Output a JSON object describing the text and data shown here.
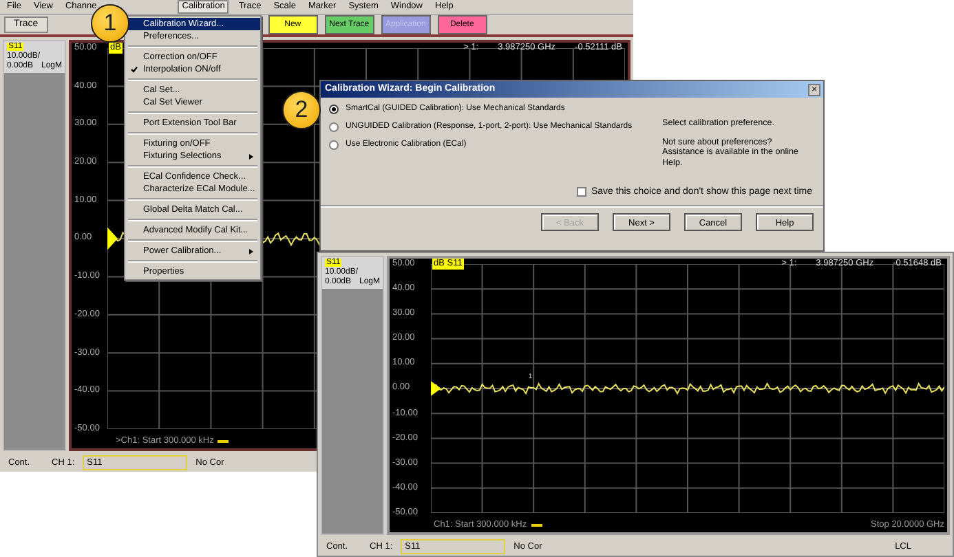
{
  "back_window": {
    "menu_bar": [
      {
        "label": "File",
        "selected": false
      },
      {
        "label": "View",
        "selected": false
      },
      {
        "label": "Channe",
        "selected": false
      },
      {
        "label": "Calibration",
        "selected": true
      },
      {
        "label": "Trace",
        "selected": false
      },
      {
        "label": "Scale",
        "selected": false
      },
      {
        "label": "Marker",
        "selected": false
      },
      {
        "label": "System",
        "selected": false
      },
      {
        "label": "Window",
        "selected": false
      },
      {
        "label": "Help",
        "selected": false
      }
    ],
    "toolbar": {
      "trace_label": "Trace",
      "buttons": [
        {
          "label": "New",
          "color": "#ffff33",
          "disabled": false
        },
        {
          "label": "Next Trace",
          "color": "#66cc66",
          "disabled": false
        },
        {
          "label": "Application",
          "color": "#9999dd",
          "disabled": true
        },
        {
          "label": "Delete",
          "color": "#ff6699",
          "disabled": false
        }
      ]
    },
    "channel_panel": {
      "trace": "S11",
      "scale": "10.00dB/",
      "reference": "0.00dB",
      "format": "LogM"
    },
    "plot": {
      "y_labels": [
        "50.00",
        "40.00",
        "30.00",
        "20.00",
        "10.00",
        "0.00",
        "-10.00",
        "-20.00",
        "-30.00",
        "-40.00",
        "-50.00"
      ],
      "trace_label": "dB",
      "marker": {
        "label": "> 1:",
        "frequency": "3.987250 GHz",
        "value": "-0.52111 dB"
      },
      "start": ">Ch1: Start  300.000 kHz"
    },
    "status_bar": {
      "mode": "Cont.",
      "channel": "CH 1:",
      "measurement": "S11",
      "correction": "No Cor"
    }
  },
  "calibration_menu": {
    "groups": [
      [
        {
          "label": "Calibration Wizard...",
          "selected": true,
          "checked": false,
          "submenu": false
        },
        {
          "label": "Preferences...",
          "selected": false,
          "checked": false,
          "submenu": false
        }
      ],
      [
        {
          "label": "Correction on/OFF",
          "selected": false,
          "checked": false,
          "submenu": false
        },
        {
          "label": "Interpolation ON/off",
          "selected": false,
          "checked": true,
          "submenu": false
        }
      ],
      [
        {
          "label": "Cal Set...",
          "selected": false,
          "checked": false,
          "submenu": false
        },
        {
          "label": "Cal Set Viewer",
          "selected": false,
          "checked": false,
          "submenu": false
        }
      ],
      [
        {
          "label": "Port Extension Tool Bar",
          "selected": false,
          "checked": false,
          "submenu": false
        }
      ],
      [
        {
          "label": "Fixturing on/OFF",
          "selected": false,
          "checked": false,
          "submenu": false
        },
        {
          "label": "Fixturing Selections",
          "selected": false,
          "checked": false,
          "submenu": true
        }
      ],
      [
        {
          "label": "ECal Confidence Check...",
          "selected": false,
          "checked": false,
          "submenu": false
        },
        {
          "label": "Characterize ECal Module...",
          "selected": false,
          "checked": false,
          "submenu": false
        }
      ],
      [
        {
          "label": "Global Delta Match Cal...",
          "selected": false,
          "checked": false,
          "submenu": false
        }
      ],
      [
        {
          "label": "Advanced Modify Cal Kit...",
          "selected": false,
          "checked": false,
          "submenu": false
        }
      ],
      [
        {
          "label": "Power Calibration...",
          "selected": false,
          "checked": false,
          "submenu": true
        }
      ],
      [
        {
          "label": "Properties",
          "selected": false,
          "checked": false,
          "submenu": false
        }
      ]
    ]
  },
  "dialog": {
    "title": "Calibration Wizard: Begin Calibration",
    "close": "×",
    "options": [
      {
        "label": "SmartCal (GUIDED Calibration): Use Mechanical Standards",
        "selected": true
      },
      {
        "label": "UNGUIDED Calibration (Response, 1-port, 2-port): Use Mechanical Standards",
        "selected": false
      },
      {
        "label": "Use Electronic Calibration (ECal)",
        "selected": false
      }
    ],
    "prompt": "Select calibration preference.",
    "help_text": "Not sure about preferences? Assistance is available in the online Help.",
    "save_choice": {
      "label": "Save this choice and don't show this page next time",
      "checked": false
    },
    "buttons": [
      {
        "label": "< Back",
        "disabled": true
      },
      {
        "label": "Next >",
        "disabled": false
      },
      {
        "label": "Cancel",
        "disabled": false
      },
      {
        "label": "Help",
        "disabled": false
      }
    ]
  },
  "front_window": {
    "channel_panel": {
      "trace": "S11",
      "scale": "10.00dB/",
      "reference": "0.00dB",
      "format": "LogM"
    },
    "plot": {
      "y_labels": [
        "50.00",
        "40.00",
        "30.00",
        "20.00",
        "10.00",
        "0.00",
        "-10.00",
        "-20.00",
        "-30.00",
        "-40.00",
        "-50.00"
      ],
      "trace_label": "dB S11",
      "marker": {
        "label": "> 1:",
        "frequency": "3.987250 GHz",
        "value": "-0.51648 dB",
        "number": "1"
      },
      "start": "Ch1: Start  300.000 kHz",
      "stop": "Stop 20.0000 GHz"
    },
    "status_bar": {
      "mode": "Cont.",
      "channel": "CH 1:",
      "measurement": "S11",
      "correction": "No Cor",
      "remote": "LCL"
    }
  },
  "callouts": [
    "1",
    "2"
  ]
}
